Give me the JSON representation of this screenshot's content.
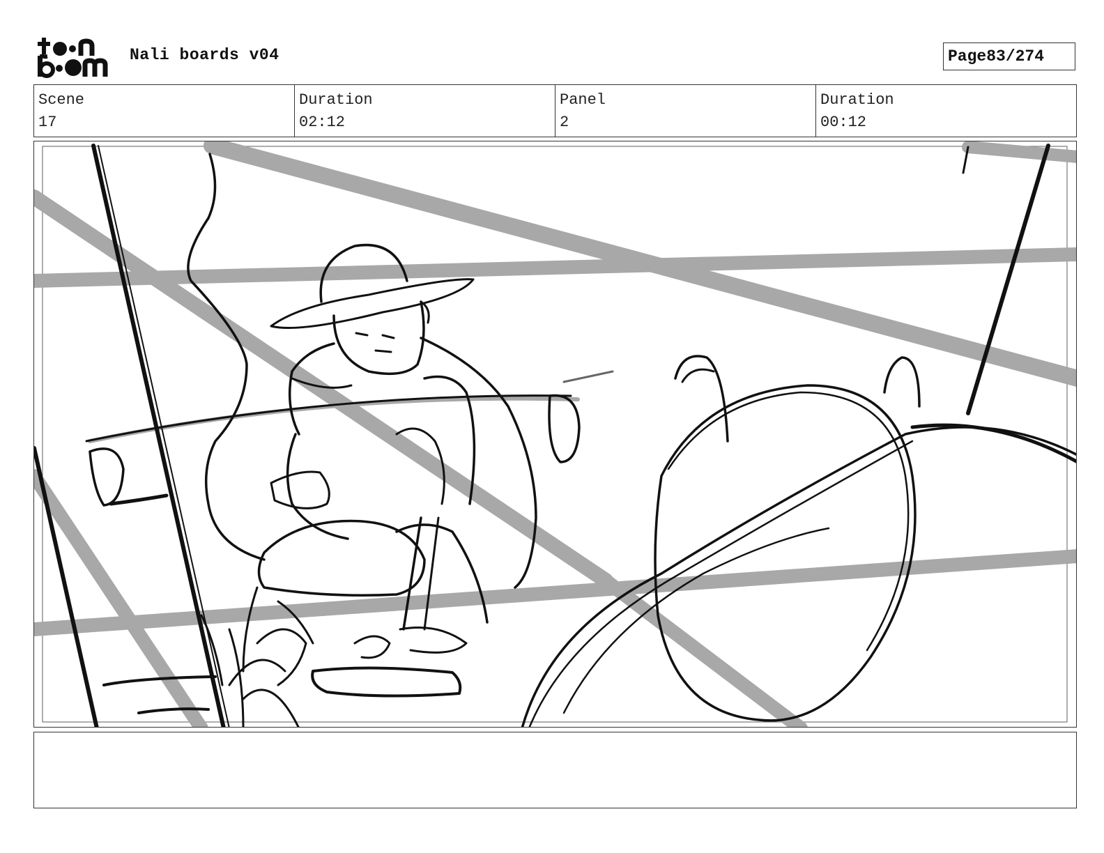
{
  "header": {
    "logo_line1": "toon",
    "logo_line2": "boom",
    "title": "Nali boards v04",
    "page_label": "Page",
    "page_value": "83/274"
  },
  "info": [
    {
      "label": "Scene",
      "value": "17"
    },
    {
      "label": "Duration",
      "value": "02:12"
    },
    {
      "label": "Panel",
      "value": "2"
    },
    {
      "label": "Duration",
      "value": "00:12"
    }
  ],
  "notes": {
    "text": ""
  },
  "colors": {
    "ink": "#111111",
    "guide": "#a8a8a8",
    "border": "#333333"
  }
}
